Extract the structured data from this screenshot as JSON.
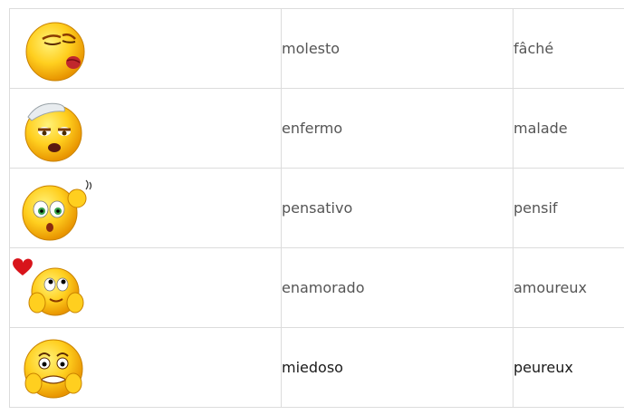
{
  "rows": [
    {
      "icon": "annoyed-face-icon",
      "spanish": "molesto",
      "french": "fâché"
    },
    {
      "icon": "sick-face-icon",
      "spanish": "enfermo",
      "french": "malade"
    },
    {
      "icon": "thinking-face-icon",
      "spanish": "pensativo",
      "french": "pensif"
    },
    {
      "icon": "in-love-face-icon",
      "spanish": "enamorado",
      "french": "amoureux"
    },
    {
      "icon": "scared-face-icon",
      "spanish": "miedoso",
      "french": "peureux"
    }
  ],
  "colors": {
    "face_light": "#ffe04a",
    "face_dark": "#f0a400",
    "border": "#dcdcdc",
    "text": "#555555",
    "heart": "#d8141b"
  }
}
